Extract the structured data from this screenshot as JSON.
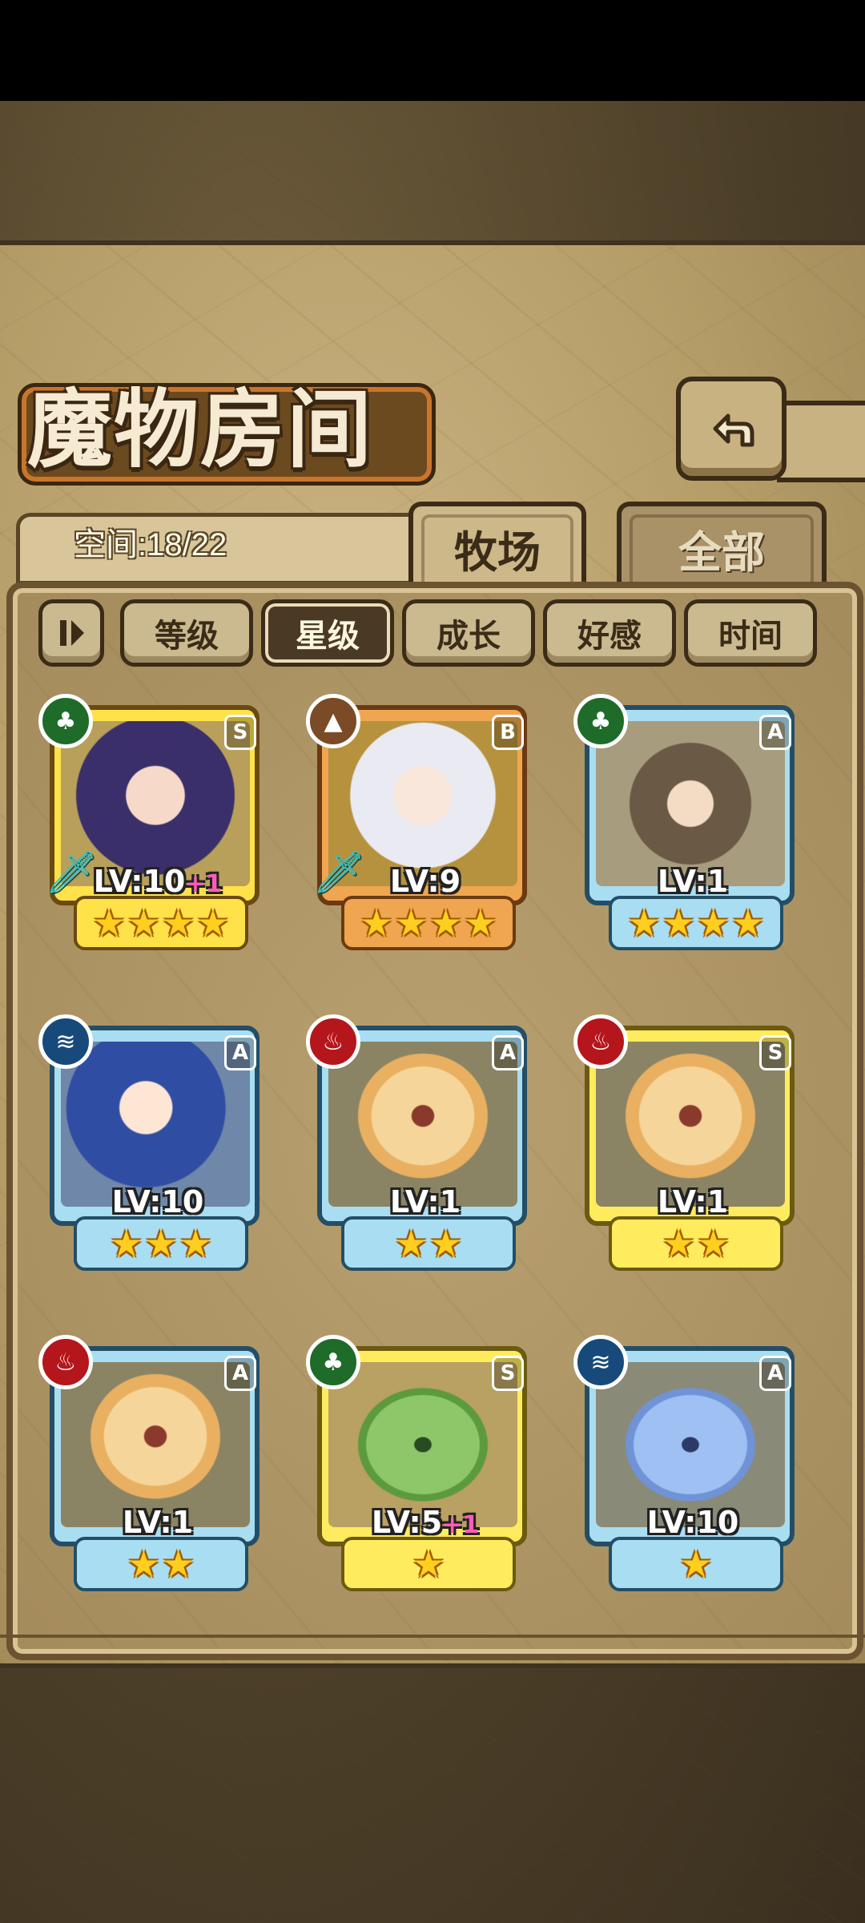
{
  "header": {
    "title": "魔物房间",
    "space_label": "空间:18/22"
  },
  "tabs": [
    {
      "label": "牧场",
      "active": true
    },
    {
      "label": "全部",
      "active": false
    }
  ],
  "sort_buttons": [
    {
      "label": "等级",
      "active": false
    },
    {
      "label": "星级",
      "active": true
    },
    {
      "label": "成长",
      "active": false
    },
    {
      "label": "好感",
      "active": false
    },
    {
      "label": "时间",
      "active": false
    }
  ],
  "monsters": [
    {
      "lv": "LV:10",
      "plus": "+1",
      "rank": "S",
      "element": "wood-icon",
      "stars": 4,
      "frame": "gold",
      "weapon": true
    },
    {
      "lv": "LV:9",
      "plus": "",
      "rank": "B",
      "element": "earth-icon",
      "stars": 4,
      "frame": "orange",
      "weapon": true
    },
    {
      "lv": "LV:1",
      "plus": "",
      "rank": "A",
      "element": "wood-icon",
      "stars": 4,
      "frame": "blue",
      "weapon": false
    },
    {
      "lv": "LV:10",
      "plus": "",
      "rank": "A",
      "element": "water-icon",
      "stars": 3,
      "frame": "blue",
      "weapon": false
    },
    {
      "lv": "LV:1",
      "plus": "",
      "rank": "A",
      "element": "fire-icon",
      "stars": 2,
      "frame": "blue",
      "weapon": false
    },
    {
      "lv": "LV:1",
      "plus": "",
      "rank": "S",
      "element": "fire-icon",
      "stars": 2,
      "frame": "yellow",
      "weapon": false
    },
    {
      "lv": "LV:1",
      "plus": "",
      "rank": "A",
      "element": "fire-icon",
      "stars": 2,
      "frame": "blue",
      "weapon": false
    },
    {
      "lv": "LV:5",
      "plus": "+1",
      "rank": "S",
      "element": "wood-icon",
      "stars": 1,
      "frame": "yellow",
      "weapon": false
    },
    {
      "lv": "LV:10",
      "plus": "",
      "rank": "A",
      "element": "water-icon",
      "stars": 1,
      "frame": "blue",
      "weapon": false
    }
  ],
  "colors": {
    "panel": "#b59d68",
    "frame_dark": "#3b2c18",
    "star": "#ffcf1f"
  }
}
